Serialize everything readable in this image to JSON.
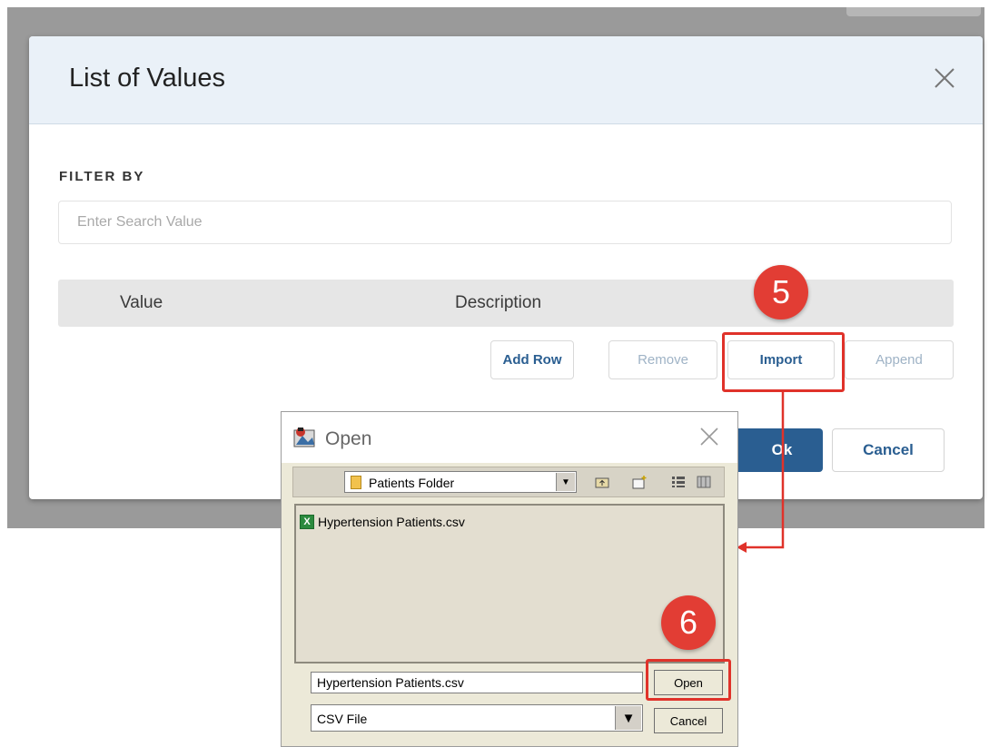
{
  "modal": {
    "title": "List of Values",
    "filter_label": "FILTER BY",
    "search_placeholder": "Enter Search Value",
    "columns": [
      "Value",
      "Description"
    ],
    "buttons": {
      "add_row": "Add Row",
      "remove": "Remove",
      "import": "Import",
      "append": "Append",
      "ok": "Ok",
      "cancel": "Cancel"
    }
  },
  "callouts": {
    "step_import": "5",
    "step_open": "6"
  },
  "open_dialog": {
    "title": "Open",
    "folder": "Patients Folder",
    "files": [
      "Hypertension Patients.csv"
    ],
    "file_name_value": "Hypertension Patients.csv",
    "file_type": "CSV File",
    "open_label": "Open",
    "cancel_label": "Cancel"
  },
  "colors": {
    "primary": "#2a5e91",
    "callout": "#e23d34",
    "highlight": "#e0322a",
    "header_bg": "#eaf1f8"
  },
  "icons": [
    "close-icon",
    "app-icon",
    "folder-icon",
    "up-folder-icon",
    "new-folder-icon",
    "list-view-icon",
    "details-view-icon",
    "csv-file-icon",
    "dropdown-arrow-icon"
  ]
}
